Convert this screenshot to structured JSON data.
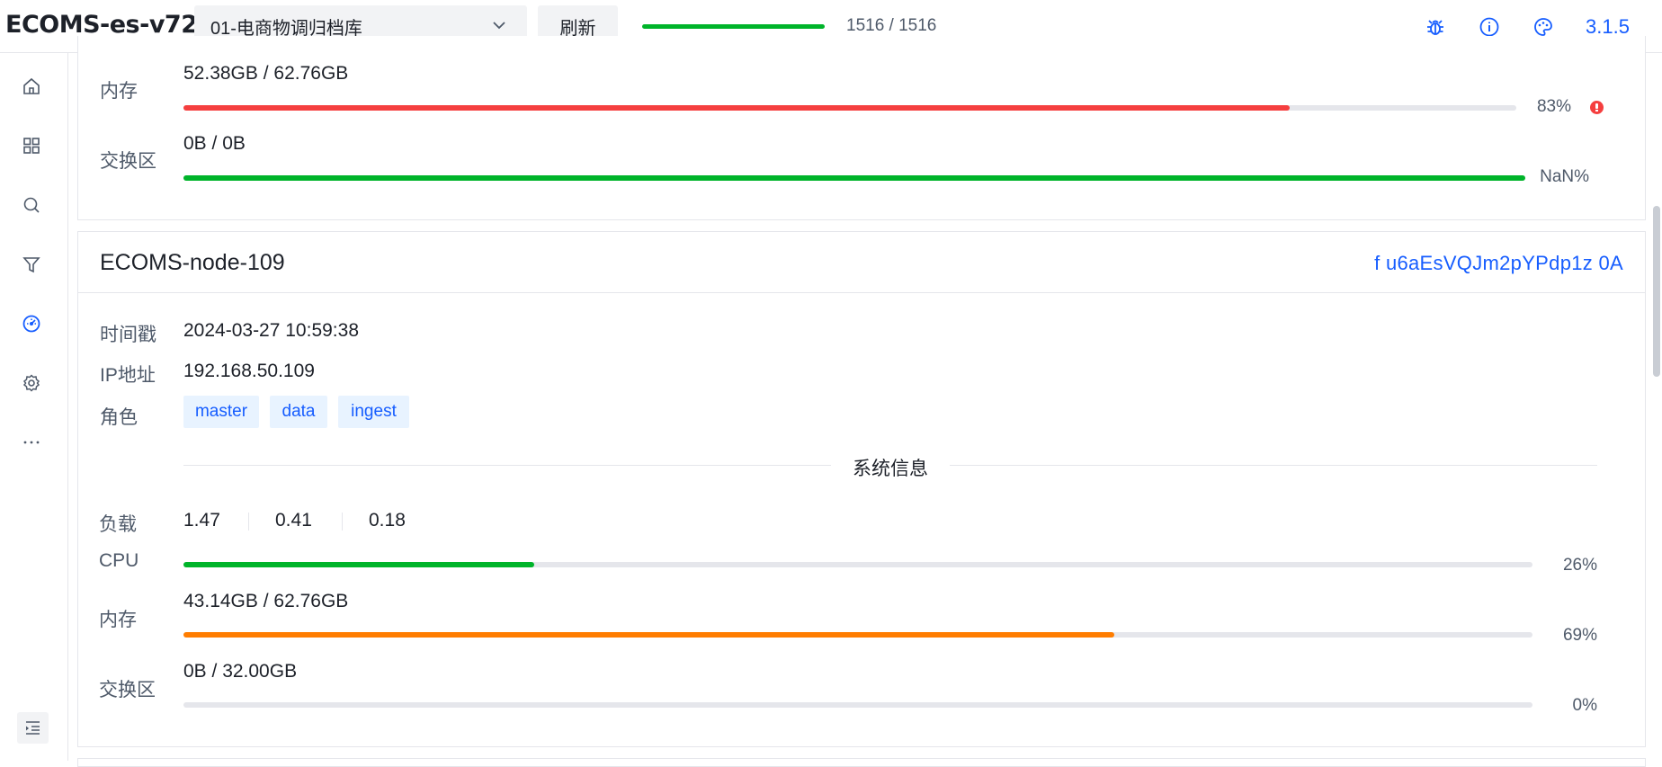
{
  "header": {
    "app_title": "ECOMS-es-v72-",
    "cluster": "01-电商物调归档库",
    "refresh": "刷新",
    "progress_text": "1516 / 1516",
    "progress_fraction": 1.0,
    "version": "3.1.5",
    "icons": [
      "bug-icon",
      "info-icon",
      "palette-icon"
    ]
  },
  "sidebar": {
    "icons": [
      "home-icon",
      "dashboard-icon",
      "search-icon",
      "filter-icon",
      "monitor-icon",
      "settings-icon",
      "more-icon"
    ],
    "active": "monitor-icon",
    "collapse_icon": "menu-fold-icon"
  },
  "node_prev": {
    "memory_label": "内存",
    "memory_value": "52.38GB / 62.76GB",
    "memory_pct": "83%",
    "memory_fraction": 0.83,
    "memory_color": "#f53f3f",
    "swap_label": "交换区",
    "swap_value": "0B / 0B",
    "swap_pct": "NaN%",
    "swap_fraction": 1.0,
    "swap_color": "#00b42a"
  },
  "node": {
    "name": "ECOMS-node-109",
    "id": "f u6aEsVQJm2pYPdp1z 0A",
    "timestamp_label": "时间戳",
    "timestamp": "2024-03-27 10:59:38",
    "ip_label": "IP地址",
    "ip": "192.168.50.109",
    "role_label": "角色",
    "roles": [
      "master",
      "data",
      "ingest"
    ],
    "sysinfo_title": "系统信息",
    "load_label": "负载",
    "load": [
      "1.47",
      "0.41",
      "0.18"
    ],
    "cpu_label": "CPU",
    "cpu_pct": "26%",
    "cpu_fraction": 0.26,
    "cpu_color": "#00b42a",
    "memory_label": "内存",
    "memory_value": "43.14GB / 62.76GB",
    "memory_pct": "69%",
    "memory_fraction": 0.69,
    "memory_color": "#ff7d00",
    "swap_label": "交换区",
    "swap_value": "0B / 32.00GB",
    "swap_pct": "0%",
    "swap_fraction": 0.0
  }
}
